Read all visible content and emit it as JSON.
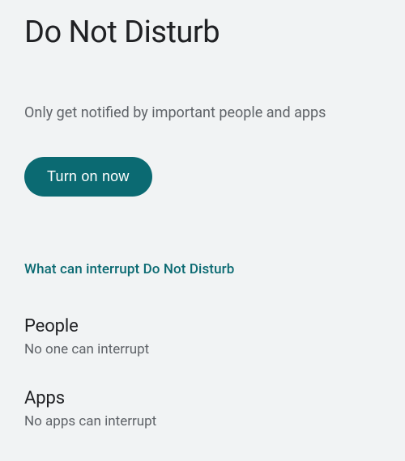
{
  "header": {
    "title": "Do Not Disturb",
    "subtitle": "Only get notified by important people and apps"
  },
  "actions": {
    "turn_on_label": "Turn on now"
  },
  "sections": {
    "interrupt_header": "What can interrupt Do Not Disturb",
    "people": {
      "title": "People",
      "summary": "No one can interrupt"
    },
    "apps": {
      "title": "Apps",
      "summary": "No apps can interrupt"
    }
  }
}
